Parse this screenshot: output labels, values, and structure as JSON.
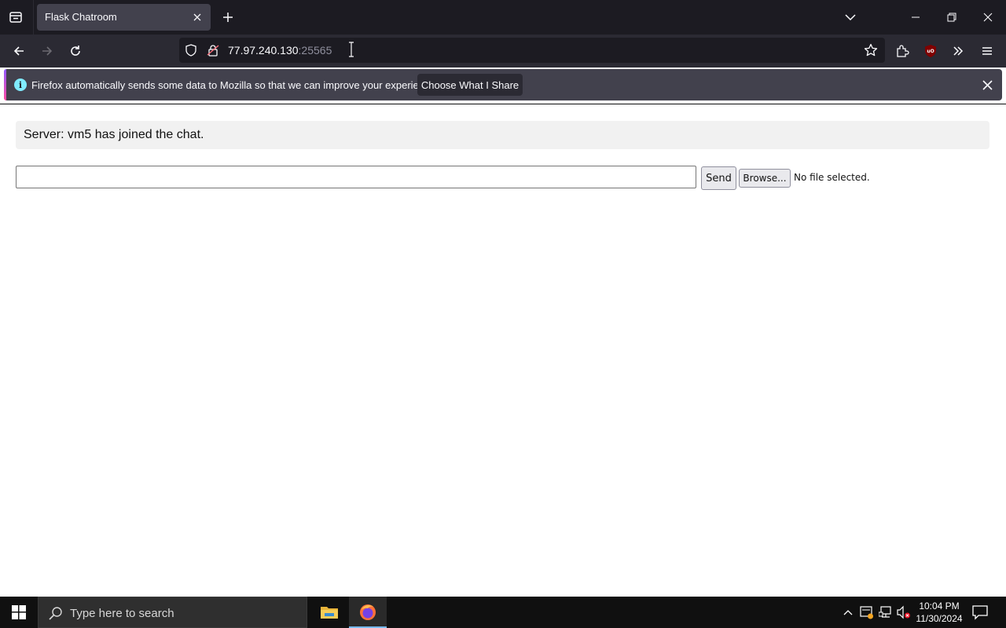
{
  "browser": {
    "tab_title": "Flask Chatroom",
    "url_host": "77.97.240.130",
    "url_port": ":25565"
  },
  "notification": {
    "text": "Firefox automatically sends some data to Mozilla so that we can improve your experience.",
    "button_label": "Choose What I Share",
    "icon_glyph": "i"
  },
  "page": {
    "messages": [
      {
        "text": "Server: vm5 has joined the chat."
      }
    ],
    "message_input_value": "",
    "send_label": "Send",
    "browse_label": "Browse...",
    "file_status": "No file selected."
  },
  "taskbar": {
    "search_placeholder": "Type here to search",
    "time": "10:04 PM",
    "date": "11/30/2024"
  },
  "colors": {
    "tabbar_bg": "#1c1b22",
    "navbar_bg": "#2b2a33",
    "notification_bg": "#42414d",
    "taskbar_bg": "#101010"
  }
}
